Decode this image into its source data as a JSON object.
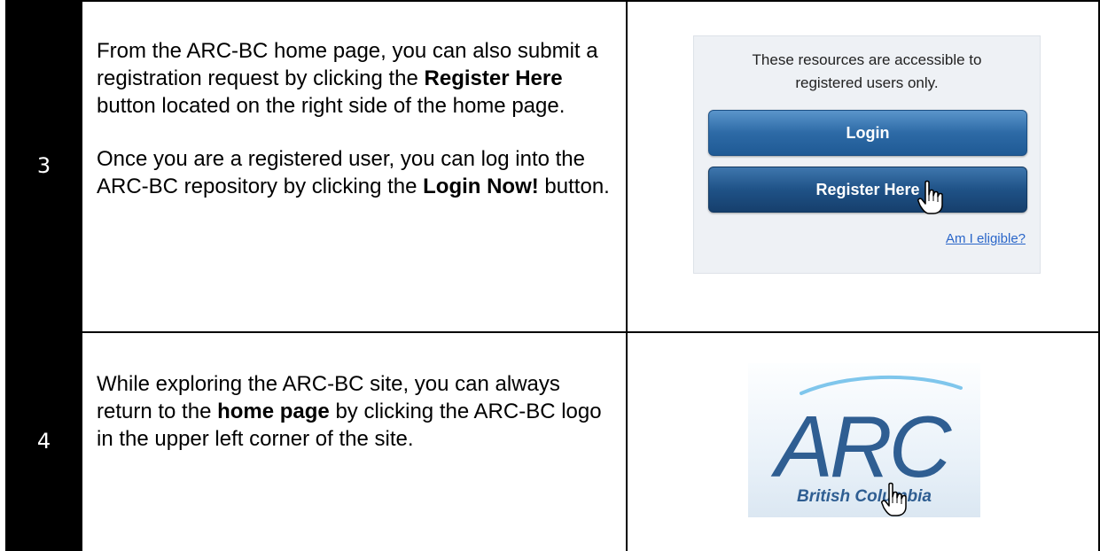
{
  "steps": [
    {
      "number": "3",
      "p1": {
        "pre": "From the ARC-BC home page, you can also submit a registration request by clicking the ",
        "bold": "Register Here",
        "post": " button located on the right side of the home page."
      },
      "p2": {
        "pre": "Once you are a registered user, you can log into the ARC-BC repository by clicking the ",
        "bold": "Login Now!",
        "post": " button."
      },
      "screenshot": {
        "message_line1": "These resources are accessible to",
        "message_line2": "registered users only.",
        "login_label": "Login",
        "register_label": "Register Here",
        "eligible_link": "Am I eligible?"
      }
    },
    {
      "number": "4",
      "p1": {
        "pre": "While exploring the ARC-BC site, you can always return to the ",
        "bold": "home page",
        "post": " by clicking the ARC-BC logo in the upper left corner of the site."
      },
      "screenshot": {
        "logo_text": "ARC",
        "logo_caption": "British Columbia"
      }
    }
  ],
  "colors": {
    "number_cell_bg": "#000000",
    "button_blue": "#2d6aa6",
    "button_dark_blue": "#1f5287",
    "link_blue": "#2a66c9",
    "logo_blue": "#2f5e92"
  }
}
